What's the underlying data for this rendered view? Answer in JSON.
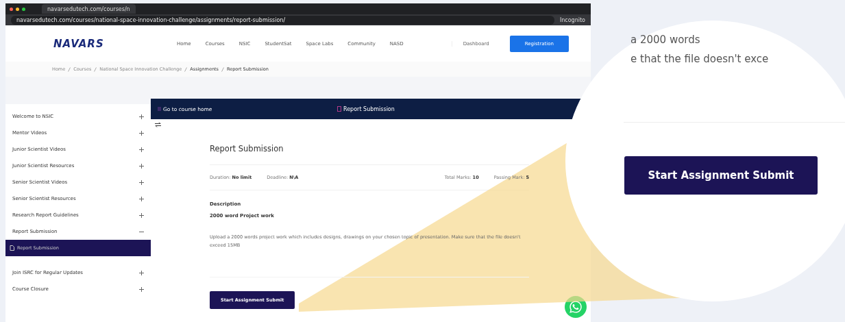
{
  "browser": {
    "tab_title": "navarsedutech.com/courses/n",
    "url": "navarsedutech.com/courses/national-space-innovation-challenge/assignments/report-submission/",
    "profile": "Incognito"
  },
  "nav": {
    "logo": "NAVARS",
    "links": [
      "Home",
      "Courses",
      "NSIC",
      "StudentSat",
      "Space Labs",
      "Community",
      "NASD"
    ],
    "dashboard": "Dashboard",
    "registration": "Registration"
  },
  "breadcrumb": [
    {
      "label": "Home",
      "current": false
    },
    {
      "label": "Courses",
      "current": false
    },
    {
      "label": "National Space Innovation Challenge",
      "current": false
    },
    {
      "label": "Assignments",
      "current": true
    },
    {
      "label": "Report Submission",
      "current": true
    }
  ],
  "sidebar": {
    "items": [
      {
        "label": "Welcome to NSIC",
        "expanded": false
      },
      {
        "label": "Mentor Videos",
        "expanded": false
      },
      {
        "label": "Junior Scientist Videos",
        "expanded": false
      },
      {
        "label": "Junior Scientist Resources",
        "expanded": false
      },
      {
        "label": "Senior Scientist Videos",
        "expanded": false
      },
      {
        "label": "Senior Scientist Resources",
        "expanded": false
      },
      {
        "label": "Research Report Guidelines",
        "expanded": false
      },
      {
        "label": "Report Submission",
        "expanded": true,
        "children": [
          {
            "label": "Report Submission",
            "selected": true
          }
        ]
      },
      {
        "label": "Join ISRC for Regular Updates",
        "expanded": false
      },
      {
        "label": "Course Closure",
        "expanded": false
      }
    ]
  },
  "course_header": {
    "back": "Go to course home",
    "title": "Report Submission"
  },
  "assignment": {
    "title": "Report Submission",
    "meta": [
      {
        "label": "Duration:",
        "value": "No limit"
      },
      {
        "label": "Deadline:",
        "value": "N\\A"
      },
      {
        "label": "Total Marks:",
        "value": "10"
      },
      {
        "label": "Passing Mark:",
        "value": "5"
      }
    ],
    "description_heading": "Description",
    "subtitle": "2000 word Project work",
    "body": "Upload a 2000 words project work which includes designs, drawings on your chosen topic of presentation. Make sure that the file doesn't exceed 15MB",
    "button": "Start Assignment Submit"
  },
  "callout": {
    "lines": [
      "a 2000 words",
      "e that the file doesn't exce"
    ],
    "button": "Start Assignment Submit"
  }
}
